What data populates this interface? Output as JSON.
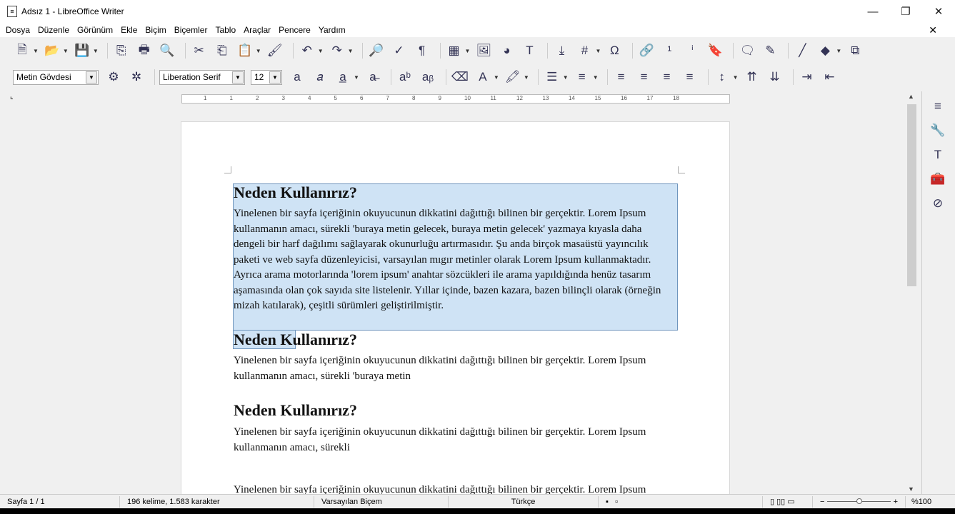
{
  "window": {
    "title": "Adsız 1 - LibreOffice Writer",
    "controls": [
      "—",
      "❐",
      "✕"
    ]
  },
  "menu": [
    "Dosya",
    "Düzenle",
    "Görünüm",
    "Ekle",
    "Biçim",
    "Biçemler",
    "Tablo",
    "Araçlar",
    "Pencere",
    "Yardım"
  ],
  "menu_close": "✕",
  "toolbar1": [
    {
      "name": "new",
      "g": "🗎",
      "dd": true
    },
    {
      "name": "open",
      "g": "📂",
      "dd": true
    },
    {
      "name": "save",
      "g": "💾",
      "dd": true
    },
    {
      "sep": true
    },
    {
      "name": "export-pdf",
      "g": "⎘"
    },
    {
      "name": "print",
      "g": "🖶"
    },
    {
      "name": "print-preview",
      "g": "🔍"
    },
    {
      "sep": true
    },
    {
      "name": "cut",
      "g": "✂"
    },
    {
      "name": "copy",
      "g": "⎗"
    },
    {
      "name": "paste",
      "g": "📋",
      "dd": true
    },
    {
      "name": "clone-formatting",
      "g": "🖌"
    },
    {
      "sep": true
    },
    {
      "name": "undo",
      "g": "↶",
      "dd": true
    },
    {
      "name": "redo",
      "g": "↷",
      "dd": true
    },
    {
      "sep": true
    },
    {
      "name": "find-replace",
      "g": "🔎"
    },
    {
      "name": "spelling",
      "g": "✓"
    },
    {
      "name": "formatting-marks",
      "g": "¶"
    },
    {
      "sep": true
    },
    {
      "name": "table",
      "g": "▦",
      "dd": true
    },
    {
      "name": "image",
      "g": "🖼"
    },
    {
      "name": "chart",
      "g": "◕"
    },
    {
      "name": "text-box",
      "g": "T"
    },
    {
      "sep": true
    },
    {
      "name": "page-break",
      "g": "⤓"
    },
    {
      "name": "field",
      "g": "#",
      "dd": true
    },
    {
      "name": "special-character",
      "g": "Ω"
    },
    {
      "sep": true
    },
    {
      "name": "hyperlink",
      "g": "🔗"
    },
    {
      "name": "footnote",
      "g": "¹"
    },
    {
      "name": "endnote",
      "g": "ⁱ"
    },
    {
      "name": "bookmark",
      "g": "🔖"
    },
    {
      "sep": true
    },
    {
      "name": "comment",
      "g": "🗨"
    },
    {
      "name": "track-changes",
      "g": "✎"
    },
    {
      "sep": true
    },
    {
      "name": "line",
      "g": "╱"
    },
    {
      "name": "shapes",
      "g": "◆",
      "dd": true
    },
    {
      "name": "draw-functions",
      "g": "⧉"
    }
  ],
  "toolbar2": {
    "style": "Metin Gövdesi",
    "font": "Liberation Serif",
    "size": "12",
    "buttons": [
      {
        "name": "bold",
        "g": "a"
      },
      {
        "name": "italic",
        "g": "𝑎"
      },
      {
        "name": "underline",
        "g": "a̲",
        "dd": true
      },
      {
        "name": "strikethrough",
        "g": "a̶"
      },
      {
        "sep": true
      },
      {
        "name": "superscript",
        "g": "aᵇ"
      },
      {
        "name": "subscript",
        "g": "aᵦ"
      },
      {
        "sep": true
      },
      {
        "name": "clear-formatting",
        "g": "⌫"
      },
      {
        "name": "font-color",
        "g": "A",
        "dd": true
      },
      {
        "name": "highlight",
        "g": "🖍",
        "dd": true
      },
      {
        "sep": true
      },
      {
        "name": "bullets",
        "g": "☰",
        "dd": true
      },
      {
        "name": "numbering",
        "g": "≡",
        "dd": true
      },
      {
        "sep": true
      },
      {
        "name": "align-left",
        "g": "≡"
      },
      {
        "name": "align-center",
        "g": "≡"
      },
      {
        "name": "align-right",
        "g": "≡"
      },
      {
        "name": "justify",
        "g": "≡"
      },
      {
        "sep": true
      },
      {
        "name": "line-spacing",
        "g": "↕",
        "dd": true
      },
      {
        "name": "para-spacing-up",
        "g": "⇈"
      },
      {
        "name": "para-spacing-down",
        "g": "⇊"
      },
      {
        "sep": true
      },
      {
        "name": "indent-increase",
        "g": "⇥"
      },
      {
        "name": "indent-decrease",
        "g": "⇤"
      }
    ]
  },
  "ruler": [
    "1",
    "1",
    "2",
    "3",
    "4",
    "5",
    "6",
    "7",
    "8",
    "9",
    "10",
    "11",
    "12",
    "13",
    "14",
    "15",
    "16",
    "17",
    "18"
  ],
  "document": {
    "heading": "Neden Kullanırız?",
    "para1": [
      "Yinelenen bir sayfa içeriğinin okuyucunun dikkatini dağıttığı bilinen bir gerçektir. Lorem Ipsum",
      "kullanmanın amacı, sürekli 'buraya metin gelecek, buraya metin gelecek' yazmaya kıyasla daha",
      "dengeli bir harf dağılımı sağlayarak okunurluğu artırmasıdır. Şu anda birçok masaüstü yayıncılık",
      "paketi ve web sayfa düzenleyicisi, varsayılan mıgır metinler olarak Lorem Ipsum kullanmaktadır.",
      "Ayrıca arama motorlarında 'lorem ipsum' anahtar sözcükleri ile arama yapıldığında henüz tasarım",
      "aşamasında olan çok sayıda site listelenir. Yıllar içinde, bazen kazara, bazen bilinçli olarak (örneğin",
      "mizah katılarak), çeşitli sürümleri geliştirilmiştir."
    ],
    "para2": [
      "Yinelenen bir sayfa içeriğinin okuyucunun dikkatini dağıttığı bilinen bir gerçektir. Lorem Ipsum",
      "kullanmanın amacı, sürekli 'buraya metin"
    ],
    "para3": [
      "Yinelenen bir sayfa içeriğinin okuyucunun dikkatini dağıttığı bilinen bir gerçektir. Lorem Ipsum",
      "kullanmanın amacı, sürekli"
    ],
    "para4": "Yinelenen bir sayfa içeriğinin okuyucunun dikkatini dağıttığı bilinen bir gerçektir. Lorem Ipsum"
  },
  "sidebar": [
    {
      "name": "properties",
      "g": "≡"
    },
    {
      "name": "styles",
      "g": "🔧"
    },
    {
      "name": "gallery",
      "g": "T"
    },
    {
      "name": "navigator",
      "g": "🧰"
    },
    {
      "name": "compass",
      "g": "⊘"
    }
  ],
  "status": {
    "page": "Sayfa 1 / 1",
    "words": "196 kelime, 1.583 karakter",
    "style": "Varsayılan Biçem",
    "language": "Türkçe",
    "zoom": "%100",
    "zoom_percent": 100
  }
}
